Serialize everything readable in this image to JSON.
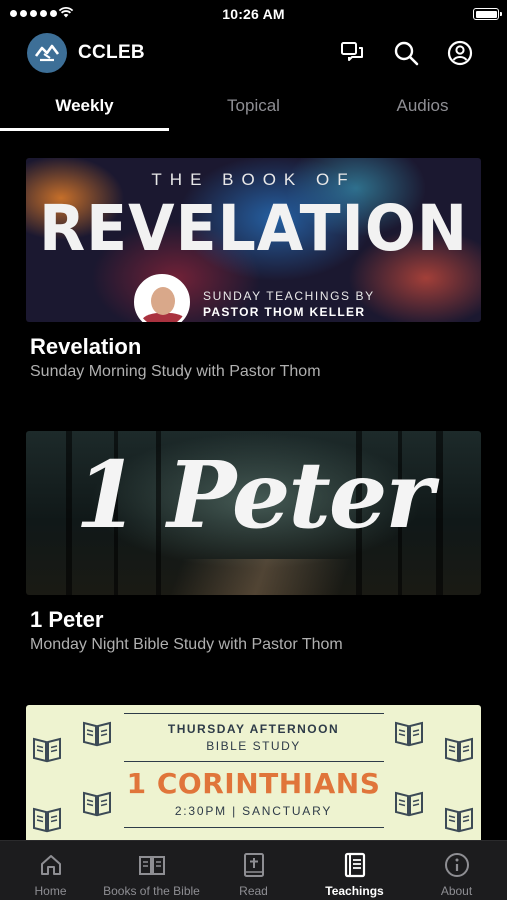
{
  "status_bar": {
    "time": "10:26 AM"
  },
  "header": {
    "app_name": "CCLEB",
    "logo_icon": "ccleb-logo-icon",
    "actions": [
      "chat-icon",
      "search-icon",
      "account-icon"
    ]
  },
  "tabs": [
    {
      "label": "Weekly",
      "active": true
    },
    {
      "label": "Topical",
      "active": false
    },
    {
      "label": "Audios",
      "active": false
    }
  ],
  "cards": [
    {
      "title": "Revelation",
      "subtitle": "Sunday Morning Study with Pastor Thom",
      "banner": {
        "line1": "THE BOOK OF",
        "line2": "REVELATION",
        "line3": "SUNDAY TEACHINGS BY",
        "line4": "PASTOR THOM KELLER"
      }
    },
    {
      "title": "1 Peter",
      "subtitle": "Monday Night Bible Study with Pastor Thom",
      "banner": {
        "line1": "1 Peter"
      }
    },
    {
      "banner": {
        "line1": "THURSDAY AFTERNOON",
        "line2": "BIBLE STUDY",
        "line3": "1 CORINTHIANS",
        "line4": "2:30PM | SANCTUARY"
      }
    }
  ],
  "bottom_nav": [
    {
      "label": "Home",
      "icon": "home-icon",
      "active": false
    },
    {
      "label": "Books of the Bible",
      "icon": "open-book-icon",
      "active": false
    },
    {
      "label": "Read",
      "icon": "bible-icon",
      "active": false
    },
    {
      "label": "Teachings",
      "icon": "teachings-icon",
      "active": true
    },
    {
      "label": "About",
      "icon": "info-icon",
      "active": false
    }
  ],
  "colors": {
    "background": "#000000",
    "tabbar": "#1c1c1e",
    "inactive": "#8e8e93",
    "logo_bg": "#3d6f97",
    "corinthians_accent": "#e0753a"
  }
}
